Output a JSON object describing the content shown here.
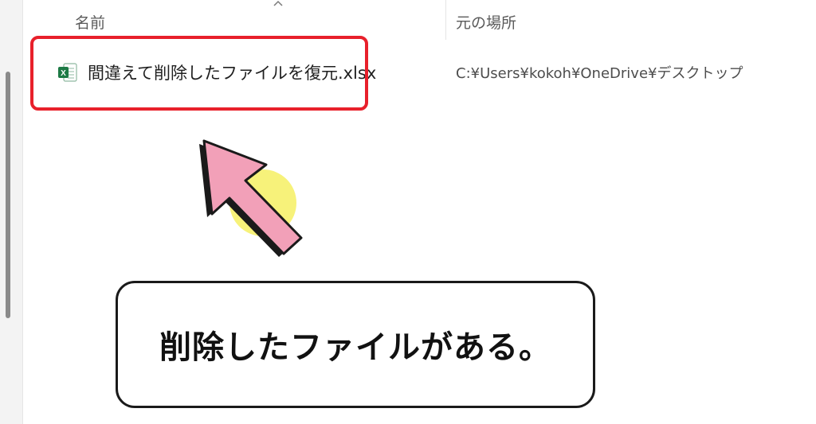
{
  "columns": {
    "name": "名前",
    "location": "元の場所"
  },
  "file": {
    "name": "間違えて削除したファイルを復元.xlsx",
    "location": "C:¥Users¥kokoh¥OneDrive¥デスクトップ",
    "icon": "excel-file-icon"
  },
  "callout": {
    "text": "削除したファイルがある。"
  },
  "colors": {
    "highlight": "#e8202b",
    "arrow_fill": "#f2a0b8",
    "arrow_glow": "#f7f27a",
    "excel_green": "#1d7a45"
  }
}
